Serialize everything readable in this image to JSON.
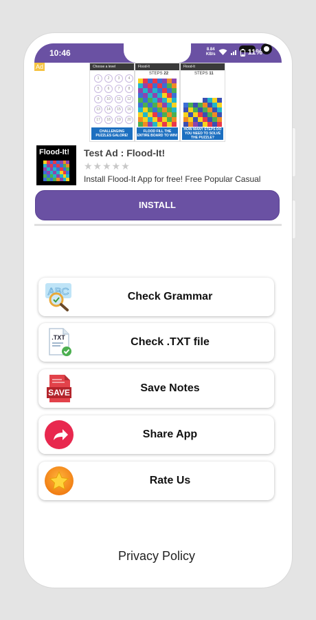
{
  "status": {
    "time": "10:46",
    "speed_value": "8.84",
    "speed_unit": "KB/s",
    "battery": "11%"
  },
  "ad": {
    "tag": "Ad",
    "screens": [
      {
        "bar": "Choose a level",
        "banner": "CHALLENGING PUZZLES GALORE!",
        "numbers": [
          "1",
          "2",
          "3",
          "4",
          "5",
          "6",
          "7",
          "8",
          "9",
          "10",
          "11",
          "12",
          "13",
          "14",
          "15",
          "16",
          "17",
          "18",
          "19",
          "20"
        ]
      },
      {
        "bar": "Flood-It",
        "steps_label": "STEPS",
        "steps": "22",
        "banner": "FLOOD FILL THE ENTIRE BOARD TO WIN!"
      },
      {
        "bar": "Flood-It",
        "steps_label": "STEPS",
        "steps": "11",
        "banner": "HOW MANY STEPS DO YOU NEED TO SOLVE THE PUZZLE?"
      }
    ],
    "logo_text": "Flood-It!",
    "title": "Test Ad : Flood-It!",
    "rating_stars": 0,
    "stars_text": "★★★★★",
    "description": "Install Flood-It App for free! Free Popular Casual",
    "install_label": "INSTALL"
  },
  "menu": [
    {
      "label": "Check Grammar",
      "icon": "abc-magnifier-icon",
      "icon_text": "ABC"
    },
    {
      "label": "Check .TXT file",
      "icon": "txt-file-check-icon",
      "icon_text": ".TXT"
    },
    {
      "label": "Save Notes",
      "icon": "save-document-icon",
      "icon_text": "SAVE"
    },
    {
      "label": "Share App",
      "icon": "share-arrow-icon",
      "icon_text": ""
    },
    {
      "label": "Rate Us",
      "icon": "star-icon",
      "icon_text": ""
    }
  ],
  "footer": {
    "privacy_label": "Privacy Policy"
  },
  "colors": {
    "primary": "#6a51a3",
    "share": "#e8284e",
    "rate": "#f39c12",
    "save": "#e74c3c"
  }
}
